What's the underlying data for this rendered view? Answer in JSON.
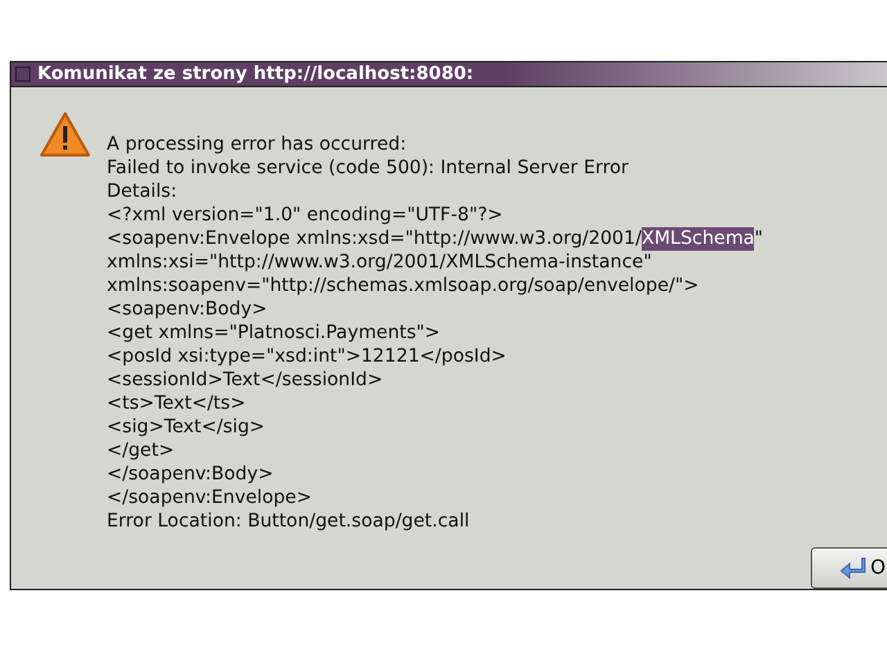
{
  "window": {
    "title": "Komunikat ze strony http://localhost:8080:"
  },
  "message": {
    "lines": [
      {
        "parts": [
          {
            "text": "A processing error has occurred:",
            "selected": false
          }
        ]
      },
      {
        "parts": [
          {
            "text": "Failed to invoke service (code 500): Internal Server Error",
            "selected": false
          }
        ]
      },
      {
        "parts": [
          {
            "text": "Details:",
            "selected": false
          }
        ]
      },
      {
        "parts": [
          {
            "text": "<?xml version=\"1.0\" encoding=\"UTF-8\"?>",
            "selected": false
          }
        ]
      },
      {
        "parts": [
          {
            "text": "<soapenv:Envelope xmlns:xsd=\"http://www.w3.org/2001/",
            "selected": false
          },
          {
            "text": "XMLSchema",
            "selected": true
          },
          {
            "text": "\"",
            "selected": false
          }
        ]
      },
      {
        "parts": [
          {
            "text": "xmlns:xsi=\"http://www.w3.org/2001/XMLSchema-instance\"",
            "selected": false
          }
        ]
      },
      {
        "parts": [
          {
            "text": "xmlns:soapenv=\"http://schemas.xmlsoap.org/soap/envelope/\">",
            "selected": false
          }
        ]
      },
      {
        "parts": [
          {
            "text": "<soapenv:Body>",
            "selected": false
          }
        ]
      },
      {
        "parts": [
          {
            "text": "<get xmlns=\"Platnosci.Payments\">",
            "selected": false
          }
        ]
      },
      {
        "parts": [
          {
            "text": "<posId xsi:type=\"xsd:int\">12121</posId>",
            "selected": false
          }
        ]
      },
      {
        "parts": [
          {
            "text": "<sessionId>Text</sessionId>",
            "selected": false
          }
        ]
      },
      {
        "parts": [
          {
            "text": "<ts>Text</ts>",
            "selected": false
          }
        ]
      },
      {
        "parts": [
          {
            "text": "<sig>Text</sig>",
            "selected": false
          }
        ]
      },
      {
        "parts": [
          {
            "text": "</get>",
            "selected": false
          }
        ]
      },
      {
        "parts": [
          {
            "text": "</soapenv:Body>",
            "selected": false
          }
        ]
      },
      {
        "parts": [
          {
            "text": "</soapenv:Envelope>",
            "selected": false
          }
        ]
      },
      {
        "parts": [
          {
            "text": "Error Location: Button/get.soap/get.call",
            "selected": false
          }
        ]
      }
    ]
  },
  "buttons": [
    {
      "label": "O"
    }
  ]
}
